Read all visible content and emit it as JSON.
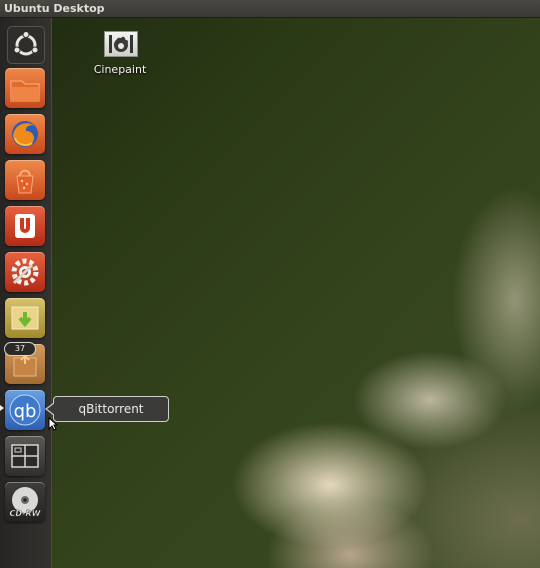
{
  "topbar": {
    "title": "Ubuntu Desktop"
  },
  "launcher": {
    "items": [
      {
        "name": "ubuntu-logo-icon"
      },
      {
        "name": "home-folder-icon"
      },
      {
        "name": "firefox-icon"
      },
      {
        "name": "software-center-icon"
      },
      {
        "name": "ubuntu-one-icon"
      },
      {
        "name": "system-settings-icon"
      },
      {
        "name": "update-manager-icon"
      },
      {
        "name": "package-icon",
        "badge": "37"
      },
      {
        "name": "qbittorrent-icon",
        "label": "qb"
      },
      {
        "name": "workspace-switcher-icon"
      },
      {
        "name": "cd-rw-icon",
        "label": "CD-RW"
      }
    ],
    "tooltip": "qBittorrent"
  },
  "desktop": {
    "icons": [
      {
        "name": "cinepaint-icon",
        "label": "Cinepaint"
      }
    ]
  },
  "colors": {
    "topbar": "#3f3d3a",
    "launcher": "#2b2a27",
    "tooltip_bg": "#3b3b39"
  }
}
